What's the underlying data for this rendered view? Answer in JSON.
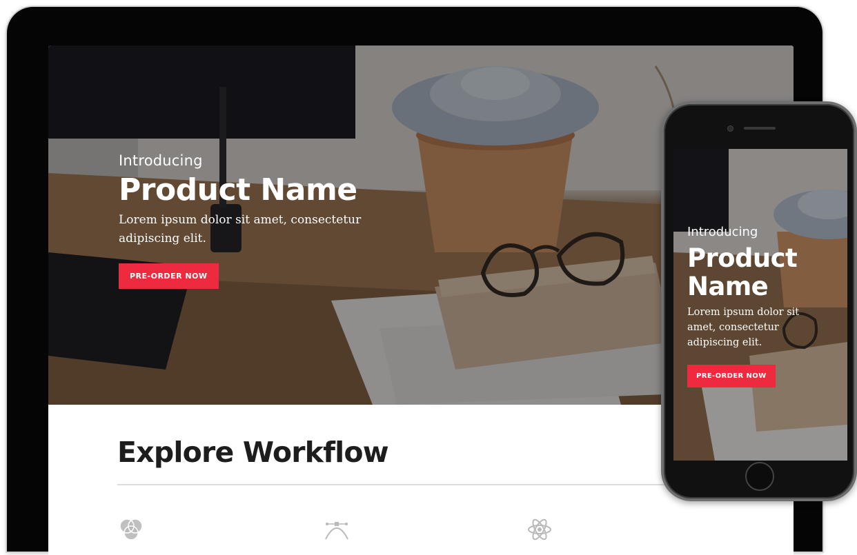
{
  "hero": {
    "eyebrow": "Introducing",
    "title": "Product Name",
    "description": "Lorem ipsum dolor sit amet, consectetur adipiscing elit.",
    "cta_label": "PRE-ORDER NOW",
    "cta_color": "#ee2b3e"
  },
  "explore": {
    "title": "Explore Workflow",
    "features": [
      {
        "icon": "venn-diagram-icon"
      },
      {
        "icon": "bezier-curve-icon"
      },
      {
        "icon": "atom-icon"
      }
    ]
  },
  "phone": {
    "eyebrow": "Introducing",
    "title": "Product Name",
    "description": "Lorem ipsum dolor sit amet, consectetur adipiscing elit.",
    "cta_label": "PRE-ORDER NOW"
  }
}
